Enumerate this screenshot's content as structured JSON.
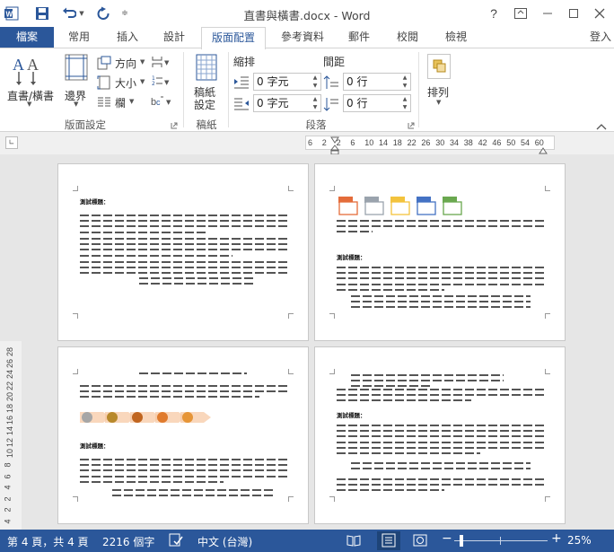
{
  "title_bar": {
    "doc_title": "直書與橫書.docx - Word",
    "help": "?"
  },
  "tabs": [
    "檔案",
    "常用",
    "插入",
    "設計",
    "版面配置",
    "參考資料",
    "郵件",
    "校閱",
    "檢視"
  ],
  "signin": "登入",
  "ribbon": {
    "text_direction": "直書/橫書",
    "margins": "邊界",
    "orientation": "方向",
    "size": "大小",
    "columns": "欄",
    "group_page_setup": "版面設定",
    "manuscript": "稿紙\n設定",
    "manuscript_line1": "稿紙",
    "manuscript_line2": "設定",
    "group_manuscript": "稿紙",
    "indent_label": "縮排",
    "spacing_label": "間距",
    "indent_left": "0 字元",
    "indent_right": "0 字元",
    "spacing_before": "0 行",
    "spacing_after": "0 行",
    "group_paragraph": "段落",
    "arrange": "排列"
  },
  "ruler_ticks": [
    "6",
    "2",
    "2",
    "6",
    "10",
    "14",
    "18",
    "22",
    "26",
    "30",
    "34",
    "38",
    "42",
    "46",
    "50",
    "54",
    "60"
  ],
  "vruler_ticks": [
    "4",
    "2",
    "2",
    "4",
    "6",
    "8",
    "10",
    "12",
    "14",
    "16",
    "18",
    "20",
    "22",
    "24",
    "26",
    "28"
  ],
  "pages": {
    "heading": "測試標題："
  },
  "status": {
    "page": "第 4 頁，共 4 頁",
    "words": "2216 個字",
    "language": "中文 (台灣)",
    "zoom": "25%"
  },
  "colors": {
    "accent": "#2b579a",
    "workspace": "#e6e6e6"
  }
}
